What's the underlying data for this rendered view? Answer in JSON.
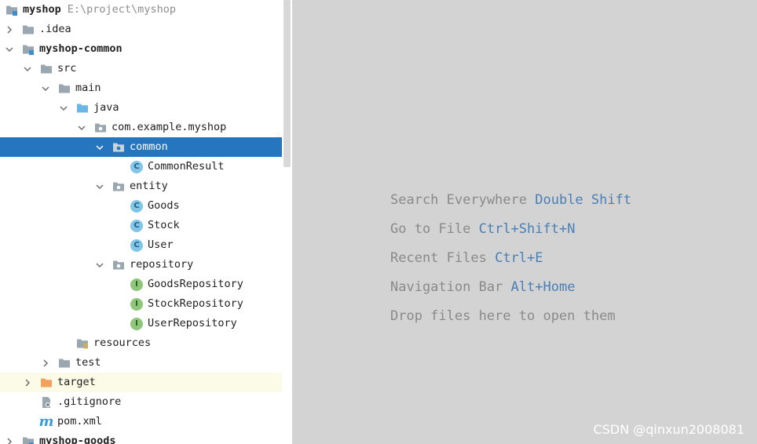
{
  "project_tree": {
    "rows": [
      {
        "id": "myshop",
        "label": "myshop",
        "path": "E:\\project\\myshop",
        "icon": "module-folder-icon"
      },
      {
        "id": "idea",
        "label": ".idea",
        "icon": "folder-icon"
      },
      {
        "id": "myshop-common",
        "label": "myshop-common",
        "icon": "module-folder-icon"
      },
      {
        "id": "src",
        "label": "src",
        "icon": "folder-icon"
      },
      {
        "id": "main",
        "label": "main",
        "icon": "folder-icon"
      },
      {
        "id": "java",
        "label": "java",
        "icon": "source-root-folder-icon"
      },
      {
        "id": "package",
        "label": "com.example.myshop",
        "icon": "package-icon"
      },
      {
        "id": "common",
        "label": "common",
        "icon": "package-icon"
      },
      {
        "id": "commonresult",
        "label": "CommonResult",
        "icon": "class-icon"
      },
      {
        "id": "entity",
        "label": "entity",
        "icon": "package-icon"
      },
      {
        "id": "goods",
        "label": "Goods",
        "icon": "class-icon"
      },
      {
        "id": "stock",
        "label": "Stock",
        "icon": "class-icon"
      },
      {
        "id": "user",
        "label": "User",
        "icon": "class-icon"
      },
      {
        "id": "repository",
        "label": "repository",
        "icon": "package-icon"
      },
      {
        "id": "goodsrepository",
        "label": "GoodsRepository",
        "icon": "interface-icon"
      },
      {
        "id": "stockrepository",
        "label": "StockRepository",
        "icon": "interface-icon"
      },
      {
        "id": "userrepository",
        "label": "UserRepository",
        "icon": "interface-icon"
      },
      {
        "id": "resources",
        "label": "resources",
        "icon": "resources-folder-icon"
      },
      {
        "id": "test",
        "label": "test",
        "icon": "folder-icon"
      },
      {
        "id": "target",
        "label": "target",
        "icon": "excluded-folder-icon"
      },
      {
        "id": "gitignore",
        "label": ".gitignore",
        "icon": "gitignore-file-icon"
      },
      {
        "id": "pom",
        "label": "pom.xml",
        "icon": "maven-icon"
      },
      {
        "id": "myshop-goods",
        "label": "myshop-goods",
        "icon": "module-folder-icon"
      }
    ],
    "class_badge": "C",
    "interface_badge": "I",
    "selected": "common"
  },
  "editor_hints": {
    "search_everywhere": {
      "text": "Search Everywhere",
      "shortcut": "Double Shift"
    },
    "go_to_file": {
      "text": "Go to File",
      "shortcut": "Ctrl+Shift+N"
    },
    "recent_files": {
      "text": "Recent Files",
      "shortcut": "Ctrl+E"
    },
    "navigation_bar": {
      "text": "Navigation Bar",
      "shortcut": "Alt+Home"
    },
    "drop_files": {
      "text": "Drop files here to open them"
    }
  },
  "watermark": "CSDN @qinxun2008081",
  "colors": {
    "selection": "#2675bf",
    "editor_background": "#d3d3d3",
    "hint_text": "#8a8a8a",
    "shortcut_text": "#4a7fb5",
    "excluded_row": "#fbfbe8"
  }
}
